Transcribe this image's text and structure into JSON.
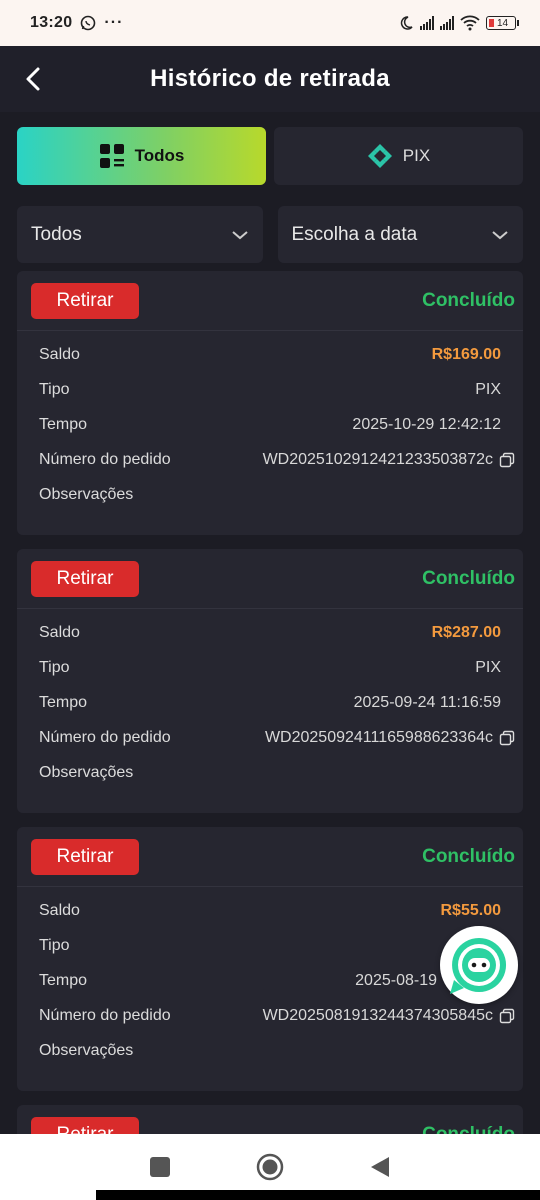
{
  "status_bar": {
    "time": "13:20",
    "battery": "14",
    "icons": [
      "whatsapp-icon",
      "more-icon",
      "moon-icon",
      "signal-icon",
      "signal-icon",
      "wifi-icon",
      "battery-icon"
    ]
  },
  "header": {
    "title": "Histórico de retirada"
  },
  "tabs": [
    {
      "label": "Todos",
      "icon": "grid-icon",
      "active": true
    },
    {
      "label": "PIX",
      "icon": "pix-icon",
      "active": false
    }
  ],
  "filters": {
    "type": "Todos",
    "date": "Escolha a data"
  },
  "labels": {
    "balance": "Saldo",
    "type": "Tipo",
    "time": "Tempo",
    "order": "Número do pedido",
    "notes": "Observações"
  },
  "records": [
    {
      "action": "Retirar",
      "status": "Concluído",
      "balance": "R$169.00",
      "type": "PIX",
      "time": "2025-10-29 12:42:12",
      "order": "WD2025102912421233503872c"
    },
    {
      "action": "Retirar",
      "status": "Concluído",
      "balance": "R$287.00",
      "type": "PIX",
      "time": "2025-09-24 11:16:59",
      "order": "WD2025092411165988623364c"
    },
    {
      "action": "Retirar",
      "status": "Concluído",
      "balance": "R$55.00",
      "type": "",
      "time": "2025-08-19",
      "order": "WD2025081913244374305845c"
    },
    {
      "action": "Retirar",
      "status": "Concluído"
    }
  ],
  "colors": {
    "accent_red": "#d92b2b",
    "status_green": "#2fc065",
    "money_orange": "#f39a3e"
  }
}
